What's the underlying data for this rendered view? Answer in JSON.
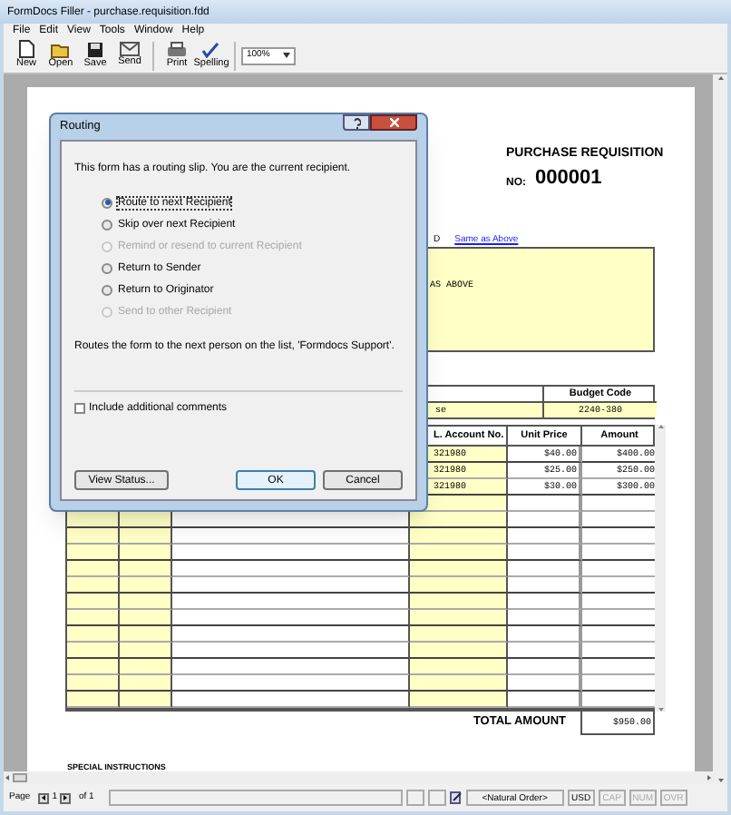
{
  "window": {
    "title": "FormDocs Filler - purchase.requisition.fdd"
  },
  "menu": [
    "File",
    "Edit",
    "View",
    "Tools",
    "Window",
    "Help"
  ],
  "toolbar": {
    "groups": [
      [
        {
          "label": "New",
          "kind": "new"
        },
        {
          "label": "Open",
          "kind": "open"
        },
        {
          "label": "Save",
          "kind": "save"
        },
        {
          "label": "Send",
          "kind": "send"
        }
      ],
      [
        {
          "label": "Print",
          "kind": "print"
        },
        {
          "label": "Spelling",
          "kind": "spelling"
        }
      ]
    ],
    "zoom": "100%"
  },
  "form": {
    "title": "PURCHASE REQUISITION",
    "number_label": "NO:",
    "number": "000001",
    "fragment": "D",
    "link": "Same as Above",
    "ship_to": "AS ABOVE",
    "budget": {
      "fragment": "se",
      "heading": "Budget Code",
      "value": "2240-380"
    },
    "items": {
      "columns": [
        "L. Account No.",
        "Unit Price",
        "Amount"
      ],
      "rows": [
        [
          "321980",
          "$40.00",
          "$400.00"
        ],
        [
          "321980",
          "$25.00",
          "$250.00"
        ],
        [
          "321980",
          "$30.00",
          "$300.00"
        ]
      ],
      "total_label": "TOTAL AMOUNT",
      "total": "$950.00"
    },
    "special_instructions": "SPECIAL INSTRUCTIONS"
  },
  "dialog": {
    "title": "Routing",
    "message": "This form has a routing slip. You are the current recipient.",
    "options": [
      {
        "label": "Route to next Recipient",
        "selected": true,
        "disabled": false
      },
      {
        "label": "Skip over next Recipient",
        "selected": false,
        "disabled": false
      },
      {
        "label": "Remind or resend to current Recipient",
        "selected": false,
        "disabled": true
      },
      {
        "label": "Return to Sender",
        "selected": false,
        "disabled": false
      },
      {
        "label": "Return to Originator",
        "selected": false,
        "disabled": false
      },
      {
        "label": "Send to other Recipient",
        "selected": false,
        "disabled": true
      }
    ],
    "description": "Routes the form to the next person on the list, 'Formdocs Support'.",
    "checkbox": {
      "label": "Include additional comments",
      "checked": false
    },
    "buttons": [
      "View Status...",
      "OK",
      "Cancel"
    ]
  },
  "status_bar": {
    "page_label": "Page",
    "page": "1",
    "of": "of 1",
    "order": "<Natural Order>",
    "currency": "USD",
    "keys": [
      {
        "label": "CAP",
        "on": false
      },
      {
        "label": "NUM",
        "on": false
      },
      {
        "label": "OVR",
        "on": false
      }
    ]
  }
}
